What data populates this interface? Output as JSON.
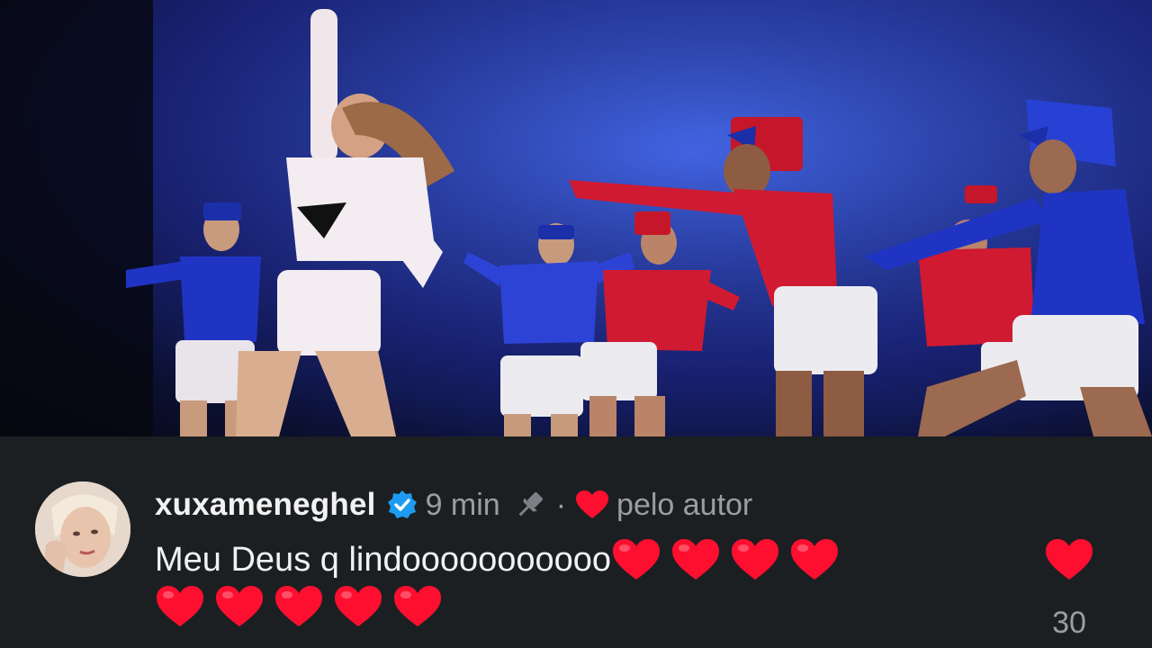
{
  "photo": {
    "description_icon": "stage-performance-photo"
  },
  "comment": {
    "username": "xuxameneghel",
    "verified_icon": "verified-badge-icon",
    "time": "9 min",
    "pinned_icon": "pin-icon",
    "separator": "·",
    "author_liked_icon": "heart-icon",
    "author_liked_label": "pelo autor",
    "text": "Meu Deus q lindooooooooooo",
    "line1_emoji_count": 4,
    "line2_emoji_count": 5,
    "emoji_name": "red-heart-emoji",
    "like_count": "30",
    "colors": {
      "heart": "#ff0f2f",
      "verified": "#1d9bf0",
      "text": "#f2f2f2",
      "muted": "#9a9ea3",
      "background": "#1c1f22"
    }
  }
}
